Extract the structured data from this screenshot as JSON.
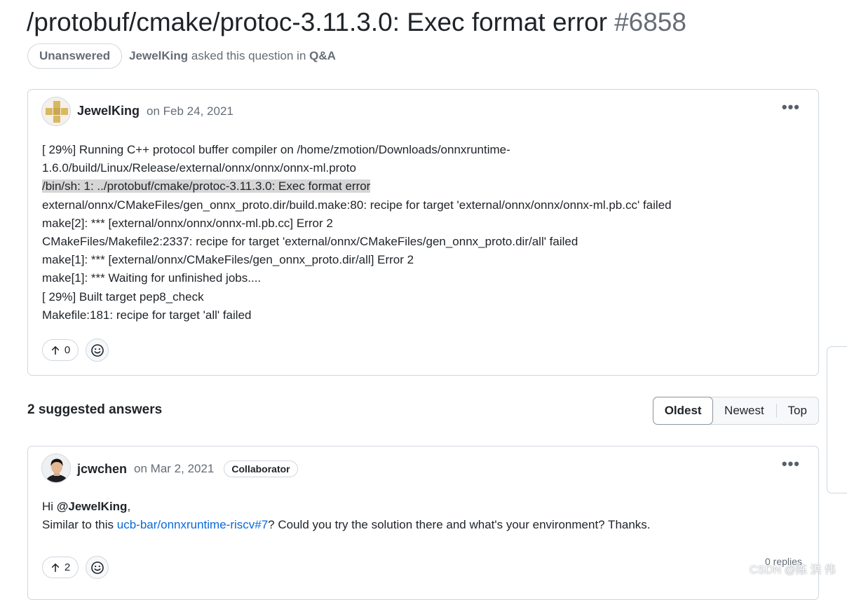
{
  "title": {
    "text": "/protobuf/cmake/protoc-3.11.3.0: Exec format error",
    "number": "#6858"
  },
  "meta": {
    "status": "Unanswered",
    "asker": "JewelKing",
    "asked_text": "asked this question in",
    "category": "Q&A"
  },
  "question": {
    "author": "JewelKing",
    "date": "on Feb 24, 2021",
    "menu_icon": "kebab-horizontal-icon",
    "lines": [
      "[ 29%] Running C++ protocol buffer compiler on /home/zmotion/Downloads/onnxruntime-",
      "1.6.0/build/Linux/Release/external/onnx/onnx/onnx-ml.proto",
      "/bin/sh: 1: ../protobuf/cmake/protoc-3.11.3.0: Exec format error",
      "external/onnx/CMakeFiles/gen_onnx_proto.dir/build.make:80: recipe for target 'external/onnx/onnx/onnx-ml.pb.cc' failed",
      "make[2]: *** [external/onnx/onnx/onnx-ml.pb.cc] Error 2",
      "CMakeFiles/Makefile2:2337: recipe for target 'external/onnx/CMakeFiles/gen_onnx_proto.dir/all' failed",
      "make[1]: *** [external/onnx/CMakeFiles/gen_onnx_proto.dir/all] Error 2",
      "make[1]: *** Waiting for unfinished jobs....",
      "[ 29%] Built target pep8_check",
      "Makefile:181: recipe for target 'all' failed"
    ],
    "votes": "0"
  },
  "answers": {
    "heading": "2 suggested answers",
    "sort_options": [
      "Oldest",
      "Newest",
      "Top"
    ],
    "first": {
      "author": "jcwchen",
      "date": "on Mar 2, 2021",
      "badge": "Collaborator",
      "greeting_prefix": "Hi ",
      "mention": "@JewelKing",
      "greeting_suffix": ",",
      "line2_prefix": "Similar to this ",
      "link": "ucb-bar/onnxruntime-riscv#7",
      "line2_suffix": "? Could you try the solution there and what's your environment? Thanks.",
      "votes": "2",
      "replies": "0 replies"
    }
  },
  "watermark": "CSDN @陈 洪 伟"
}
